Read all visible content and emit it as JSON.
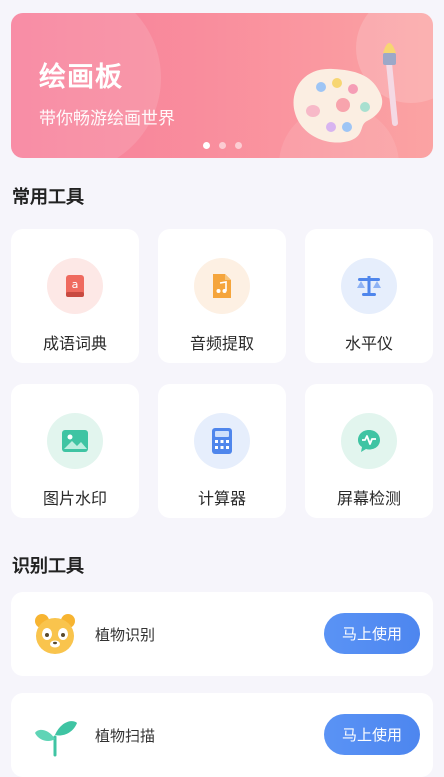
{
  "banner": {
    "title": "绘画板",
    "subtitle": "带你畅游绘画世界",
    "dots": 3,
    "active_dot": 0,
    "gradient_colors": [
      "#f77e9a",
      "#fba3a3"
    ]
  },
  "sections": {
    "common_tools_title": "常用工具",
    "recognition_tools_title": "识别工具"
  },
  "tools": [
    {
      "label": "成语词典",
      "icon": "dictionary-book-icon",
      "bg": "#fde8e6",
      "color": "#ef6a5f"
    },
    {
      "label": "音频提取",
      "icon": "audio-file-icon",
      "bg": "#fdf0e3",
      "color": "#f5a53c"
    },
    {
      "label": "水平仪",
      "icon": "level-scale-icon",
      "bg": "#e6eefc",
      "color": "#4f86ec"
    },
    {
      "label": "图片水印",
      "icon": "image-icon",
      "bg": "#e2f5ee",
      "color": "#3fc4a3"
    },
    {
      "label": "计算器",
      "icon": "calculator-icon",
      "bg": "#e6eefc",
      "color": "#4f86ec"
    },
    {
      "label": "屏幕检测",
      "icon": "screen-check-chat-icon",
      "bg": "#e2f5ee",
      "color": "#3fc4a3"
    }
  ],
  "recognition": [
    {
      "label": "植物识别",
      "button": "马上使用",
      "icon": "panda-face-icon"
    },
    {
      "label": "植物扫描",
      "button": "马上使用",
      "icon": "sprout-icon"
    }
  ],
  "colors": {
    "accent_blue": "#4d86ef",
    "page_bg": "#f6f5fb"
  }
}
